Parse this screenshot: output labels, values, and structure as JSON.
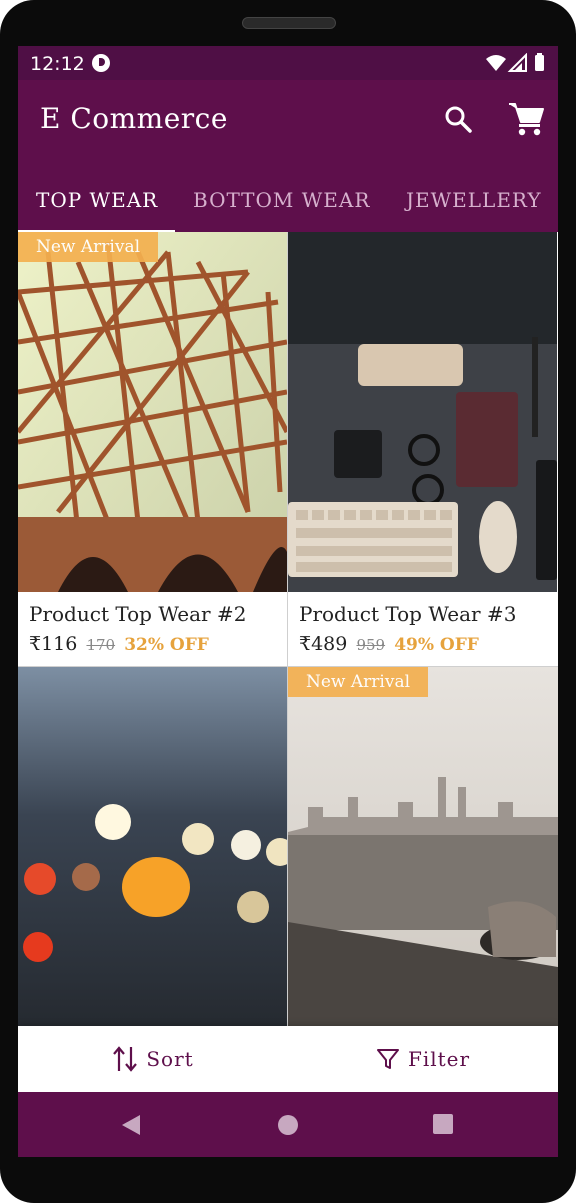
{
  "status": {
    "time": "12:12"
  },
  "appbar": {
    "title": "E Commerce",
    "search_icon": "search-icon",
    "cart_icon": "cart-icon"
  },
  "tabs": [
    {
      "label": "TOP WEAR",
      "active": true
    },
    {
      "label": "BOTTOM WEAR",
      "active": false
    },
    {
      "label": "JEWELLERY",
      "active": false
    }
  ],
  "products": [
    {
      "badge": "New Arrival",
      "name": "Product Top Wear #2",
      "price": "₹116",
      "mrp": "170",
      "discount": "32% OFF"
    },
    {
      "badge": "",
      "name": "Product Top Wear #3",
      "price": "₹489",
      "mrp": "959",
      "discount": "49% OFF"
    },
    {
      "badge": "",
      "name": "",
      "price": "",
      "mrp": "",
      "discount": ""
    },
    {
      "badge": "New Arrival",
      "name": "",
      "price": "",
      "mrp": "",
      "discount": ""
    }
  ],
  "bottom_bar": {
    "sort_label": "Sort",
    "filter_label": "Filter"
  },
  "colors": {
    "primary": "#5e0f4b",
    "status_bar": "#4f0f45",
    "accent": "#f4b04f",
    "discount": "#e6a23c"
  }
}
